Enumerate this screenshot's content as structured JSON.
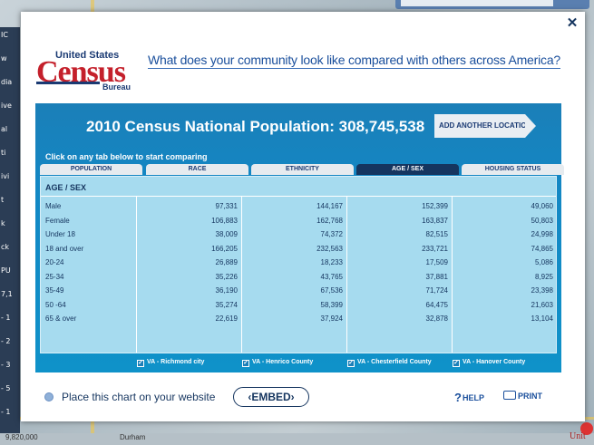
{
  "modal": {
    "logo": {
      "united_states": "United States",
      "census": "Census",
      "bureau": "Bureau"
    },
    "tagline": "What does your community look like compared with others across America?",
    "close_icon": "close-icon"
  },
  "panel": {
    "title": "2010 Census National Population: 308,745,538",
    "add_location": "ADD ANOTHER LOCATION",
    "instructions": "Click on any tab below to start comparing",
    "tabs": [
      "POPULATION",
      "RACE",
      "ETHNICITY",
      "AGE / SEX",
      "HOUSING STATUS"
    ],
    "active_tab": "AGE / SEX",
    "table_title": "AGE / SEX",
    "rows": [
      {
        "label": "Male",
        "values": [
          "97,331",
          "144,167",
          "152,399",
          "49,060"
        ]
      },
      {
        "label": "Female",
        "values": [
          "106,883",
          "162,768",
          "163,837",
          "50,803"
        ]
      },
      {
        "label": "Under 18",
        "values": [
          "38,009",
          "74,372",
          "82,515",
          "24,998"
        ]
      },
      {
        "label": "18 and over",
        "values": [
          "166,205",
          "232,563",
          "233,721",
          "74,865"
        ]
      },
      {
        "label": "20-24",
        "values": [
          "26,889",
          "18,233",
          "17,509",
          "5,086"
        ]
      },
      {
        "label": "25-34",
        "values": [
          "35,226",
          "43,765",
          "37,881",
          "8,925"
        ]
      },
      {
        "label": "35-49",
        "values": [
          "36,190",
          "67,536",
          "71,724",
          "23,398"
        ]
      },
      {
        "label": "50 -64",
        "values": [
          "35,274",
          "58,399",
          "64,475",
          "21,603"
        ]
      },
      {
        "label": "65 & over",
        "values": [
          "22,619",
          "37,924",
          "32,878",
          "13,104"
        ]
      }
    ],
    "locations": [
      "VA - Richmond city",
      "VA - Henrico County",
      "VA - Chesterfield County",
      "VA - Hanover County"
    ]
  },
  "footer": {
    "embed_text": "Place this chart on your website",
    "embed_button": "EMBED",
    "help": "HELP",
    "print": "PRINT"
  },
  "background": {
    "bottom_labels": [
      "9,820,000",
      "Durham"
    ],
    "side_labels": [
      "IC",
      "w",
      "dia",
      "ive",
      "al",
      "ti",
      "ivi",
      "t",
      "k",
      "ck",
      "PU",
      "7,1",
      "- 1",
      "- 2",
      "- 3",
      "- 5",
      "- 1"
    ],
    "right_label": "Unit"
  }
}
